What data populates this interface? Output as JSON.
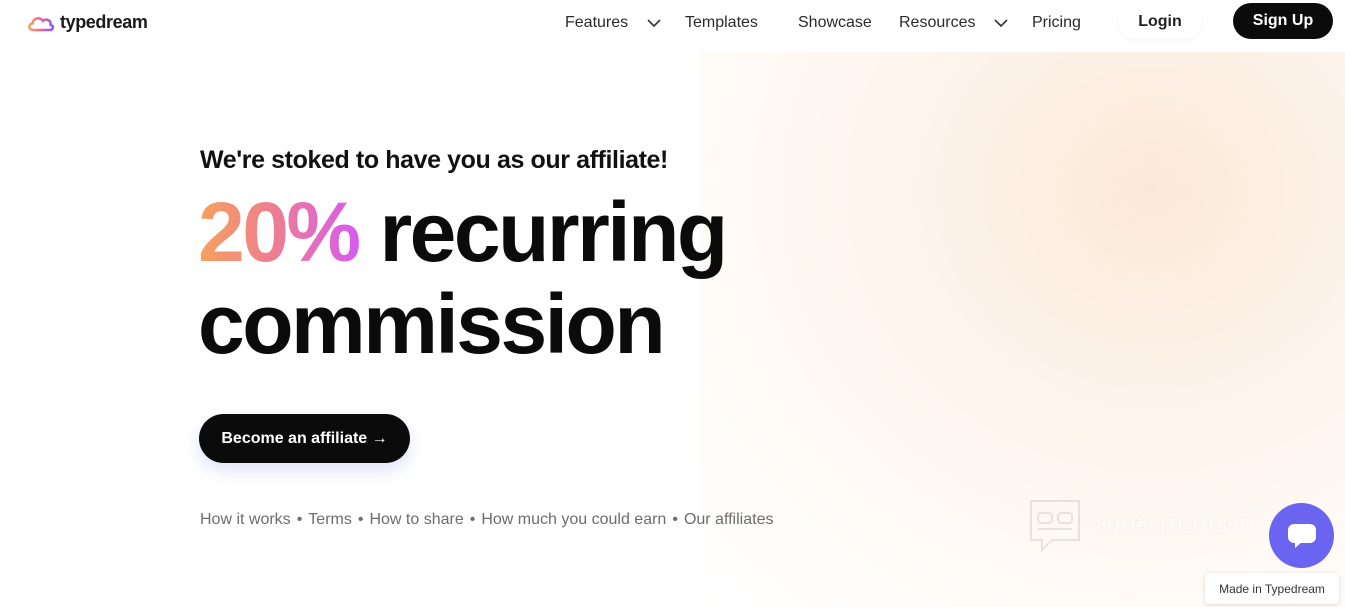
{
  "header": {
    "logo_text": "typedream",
    "nav": {
      "features": "Features",
      "templates": "Templates",
      "showcase": "Showcase",
      "resources": "Resources",
      "pricing": "Pricing"
    },
    "login_label": "Login",
    "signup_label": "Sign Up"
  },
  "hero": {
    "eyebrow": "We're stoked to have you as our affiliate!",
    "headline_highlight": "20%",
    "headline_rest_line1": " recurring",
    "headline_line2": "commission",
    "cta_label": "Become an affiliate →",
    "links": [
      "How it works",
      "Terms",
      "How to share",
      "How much you could earn",
      "Our affiliates"
    ],
    "link_separator": "•"
  },
  "watermark_text": "ПАРТНЕРКИН",
  "badge_label": "Made in Typedream",
  "colors": {
    "accent_gradient_start": "#f6a25e",
    "accent_gradient_end": "#d65bf0",
    "chat_button": "#6a64f0",
    "primary_button": "#0b0b0b"
  },
  "icons": {
    "logo": "cloud-logo-icon",
    "dropdown": "chevron-down-icon",
    "chat": "chat-bubble-icon",
    "watermark": "watermark-logo-icon"
  }
}
